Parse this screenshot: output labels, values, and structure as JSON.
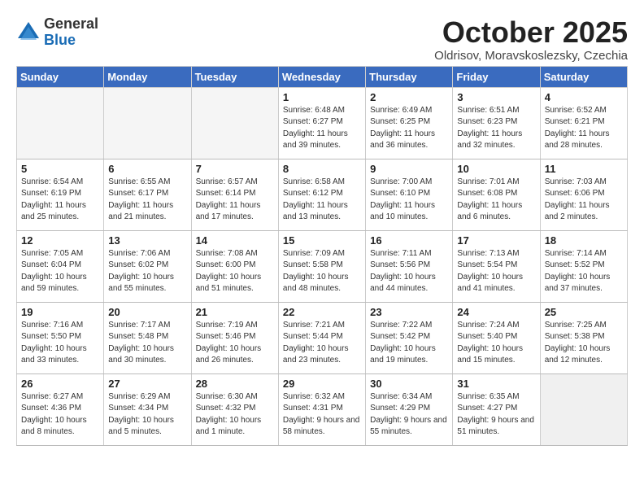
{
  "logo": {
    "general": "General",
    "blue": "Blue"
  },
  "title": "October 2025",
  "subtitle": "Oldrisov, Moravskoslezsky, Czechia",
  "days_of_week": [
    "Sunday",
    "Monday",
    "Tuesday",
    "Wednesday",
    "Thursday",
    "Friday",
    "Saturday"
  ],
  "weeks": [
    [
      {
        "num": "",
        "info": ""
      },
      {
        "num": "",
        "info": ""
      },
      {
        "num": "",
        "info": ""
      },
      {
        "num": "1",
        "info": "Sunrise: 6:48 AM\nSunset: 6:27 PM\nDaylight: 11 hours\nand 39 minutes."
      },
      {
        "num": "2",
        "info": "Sunrise: 6:49 AM\nSunset: 6:25 PM\nDaylight: 11 hours\nand 36 minutes."
      },
      {
        "num": "3",
        "info": "Sunrise: 6:51 AM\nSunset: 6:23 PM\nDaylight: 11 hours\nand 32 minutes."
      },
      {
        "num": "4",
        "info": "Sunrise: 6:52 AM\nSunset: 6:21 PM\nDaylight: 11 hours\nand 28 minutes."
      }
    ],
    [
      {
        "num": "5",
        "info": "Sunrise: 6:54 AM\nSunset: 6:19 PM\nDaylight: 11 hours\nand 25 minutes."
      },
      {
        "num": "6",
        "info": "Sunrise: 6:55 AM\nSunset: 6:17 PM\nDaylight: 11 hours\nand 21 minutes."
      },
      {
        "num": "7",
        "info": "Sunrise: 6:57 AM\nSunset: 6:14 PM\nDaylight: 11 hours\nand 17 minutes."
      },
      {
        "num": "8",
        "info": "Sunrise: 6:58 AM\nSunset: 6:12 PM\nDaylight: 11 hours\nand 13 minutes."
      },
      {
        "num": "9",
        "info": "Sunrise: 7:00 AM\nSunset: 6:10 PM\nDaylight: 11 hours\nand 10 minutes."
      },
      {
        "num": "10",
        "info": "Sunrise: 7:01 AM\nSunset: 6:08 PM\nDaylight: 11 hours\nand 6 minutes."
      },
      {
        "num": "11",
        "info": "Sunrise: 7:03 AM\nSunset: 6:06 PM\nDaylight: 11 hours\nand 2 minutes."
      }
    ],
    [
      {
        "num": "12",
        "info": "Sunrise: 7:05 AM\nSunset: 6:04 PM\nDaylight: 10 hours\nand 59 minutes."
      },
      {
        "num": "13",
        "info": "Sunrise: 7:06 AM\nSunset: 6:02 PM\nDaylight: 10 hours\nand 55 minutes."
      },
      {
        "num": "14",
        "info": "Sunrise: 7:08 AM\nSunset: 6:00 PM\nDaylight: 10 hours\nand 51 minutes."
      },
      {
        "num": "15",
        "info": "Sunrise: 7:09 AM\nSunset: 5:58 PM\nDaylight: 10 hours\nand 48 minutes."
      },
      {
        "num": "16",
        "info": "Sunrise: 7:11 AM\nSunset: 5:56 PM\nDaylight: 10 hours\nand 44 minutes."
      },
      {
        "num": "17",
        "info": "Sunrise: 7:13 AM\nSunset: 5:54 PM\nDaylight: 10 hours\nand 41 minutes."
      },
      {
        "num": "18",
        "info": "Sunrise: 7:14 AM\nSunset: 5:52 PM\nDaylight: 10 hours\nand 37 minutes."
      }
    ],
    [
      {
        "num": "19",
        "info": "Sunrise: 7:16 AM\nSunset: 5:50 PM\nDaylight: 10 hours\nand 33 minutes."
      },
      {
        "num": "20",
        "info": "Sunrise: 7:17 AM\nSunset: 5:48 PM\nDaylight: 10 hours\nand 30 minutes."
      },
      {
        "num": "21",
        "info": "Sunrise: 7:19 AM\nSunset: 5:46 PM\nDaylight: 10 hours\nand 26 minutes."
      },
      {
        "num": "22",
        "info": "Sunrise: 7:21 AM\nSunset: 5:44 PM\nDaylight: 10 hours\nand 23 minutes."
      },
      {
        "num": "23",
        "info": "Sunrise: 7:22 AM\nSunset: 5:42 PM\nDaylight: 10 hours\nand 19 minutes."
      },
      {
        "num": "24",
        "info": "Sunrise: 7:24 AM\nSunset: 5:40 PM\nDaylight: 10 hours\nand 15 minutes."
      },
      {
        "num": "25",
        "info": "Sunrise: 7:25 AM\nSunset: 5:38 PM\nDaylight: 10 hours\nand 12 minutes."
      }
    ],
    [
      {
        "num": "26",
        "info": "Sunrise: 6:27 AM\nSunset: 4:36 PM\nDaylight: 10 hours\nand 8 minutes."
      },
      {
        "num": "27",
        "info": "Sunrise: 6:29 AM\nSunset: 4:34 PM\nDaylight: 10 hours\nand 5 minutes."
      },
      {
        "num": "28",
        "info": "Sunrise: 6:30 AM\nSunset: 4:32 PM\nDaylight: 10 hours\nand 1 minute."
      },
      {
        "num": "29",
        "info": "Sunrise: 6:32 AM\nSunset: 4:31 PM\nDaylight: 9 hours\nand 58 minutes."
      },
      {
        "num": "30",
        "info": "Sunrise: 6:34 AM\nSunset: 4:29 PM\nDaylight: 9 hours\nand 55 minutes."
      },
      {
        "num": "31",
        "info": "Sunrise: 6:35 AM\nSunset: 4:27 PM\nDaylight: 9 hours\nand 51 minutes."
      },
      {
        "num": "",
        "info": ""
      }
    ]
  ]
}
